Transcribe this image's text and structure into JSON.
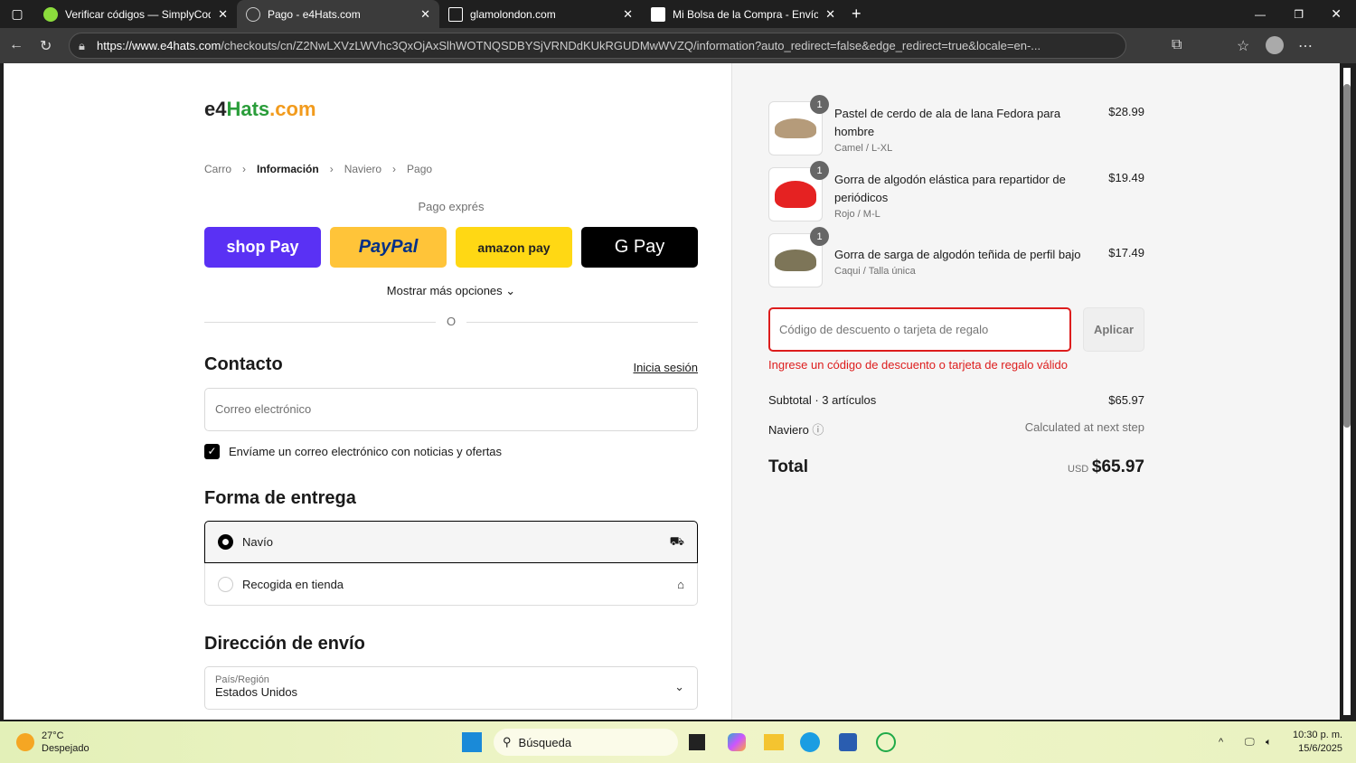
{
  "browser": {
    "tabs": [
      {
        "title": "Verificar códigos — SimplyCodes",
        "favicon_color": "#8bdc3c",
        "active": false
      },
      {
        "title": "Pago - e4Hats.com",
        "favicon_color": "#cccccc",
        "active": true
      },
      {
        "title": "glamolondon.com",
        "favicon_color": "#ffffff",
        "active": false
      },
      {
        "title": "Mi Bolsa de la Compra - Envío Gr",
        "favicon_color": "#ffffff",
        "active": false
      }
    ],
    "url_host": "https://www.e4hats.com",
    "url_path": "/checkouts/cn/Z2NwLXVzLWVhc3QxOjAxSlhWOTNQSDBYSjVRNDdKUkRGUDMwWVZQ/information?auto_redirect=false&edge_redirect=true&locale=en-..."
  },
  "logo": "e4Hats.com",
  "breadcrumb": [
    "Carro",
    "Información",
    "Naviero",
    "Pago"
  ],
  "express": {
    "label": "Pago exprés",
    "buttons": [
      "shop Pay",
      "PayPal",
      "amazon pay",
      "G Pay"
    ],
    "more": "Mostrar más opciones",
    "or": "O"
  },
  "contact": {
    "title": "Contacto",
    "login": "Inicia sesión",
    "email_placeholder": "Correo electrónico",
    "newsletter": "Envíame un correo electrónico con noticias y ofertas",
    "newsletter_checked": true
  },
  "delivery": {
    "title": "Forma de entrega",
    "options": [
      {
        "label": "Navío",
        "selected": true
      },
      {
        "label": "Recogida en tienda",
        "selected": false
      }
    ]
  },
  "shipping": {
    "title": "Dirección de envío",
    "country_label": "País/Región",
    "country": "Estados Unidos"
  },
  "summary": {
    "items": [
      {
        "name": "Pastel de cerdo de ala de lana Fedora para hombre",
        "variant": "Camel / L-XL",
        "price": "$28.99",
        "qty": "1",
        "color": "#b59b7a"
      },
      {
        "name": "Gorra de algodón elástica para repartidor de periódicos",
        "variant": "Rojo / M-L",
        "price": "$19.49",
        "qty": "1",
        "color": "#e52222"
      },
      {
        "name": "Gorra de sarga de algodón teñida de perfil bajo",
        "variant": "Caqui / Talla única",
        "price": "$17.49",
        "qty": "1",
        "color": "#7d7558"
      }
    ],
    "discount_placeholder": "Código de descuento o tarjeta de regalo",
    "apply": "Aplicar",
    "error": "Ingrese un código de descuento o tarjeta de regalo válido",
    "subtotal_label": "Subtotal · 3 artículos",
    "subtotal": "$65.97",
    "shipping_label": "Naviero",
    "shipping_value": "Calculated at next step",
    "total_label": "Total",
    "currency": "USD",
    "total": "$65.97"
  },
  "taskbar": {
    "temp": "27°C",
    "weather": "Despejado",
    "search": "Búsqueda",
    "time": "10:30 p. m.",
    "date": "15/6/2025"
  }
}
